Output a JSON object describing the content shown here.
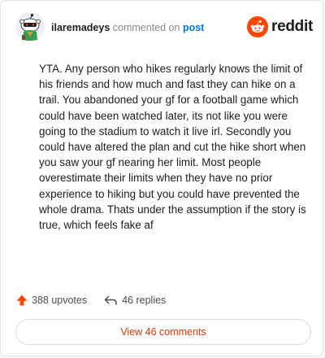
{
  "comment": {
    "username": "ilaremadeys",
    "action_text": "commented on",
    "post_link_text": "post",
    "body": "YTA. Any person who hikes regularly knows the limit of his friends and how much and fast they can hike on a trail. You abandoned your gf for a football game which could have been watched later, its not like you were going to the stadium to watch it live irl. Secondly you could have altered the plan and cut the hike short when you saw your gf nearing her limit. Most people overestimate their limits when they have no prior experience to hiking but you could have prevented the whole drama. Thats under the assumption if the story is true, which feels fake af",
    "upvotes_text": "388 upvotes",
    "replies_text": "46 replies",
    "view_comments_label": "View 46 comments"
  },
  "brand": {
    "name": "reddit",
    "logo_color": "#ff4500"
  },
  "icons": {
    "avatar": "snoo-avatar-icon",
    "logo": "reddit-snoo-icon",
    "upvote": "upvote-arrow-icon",
    "reply": "reply-arrow-icon"
  },
  "colors": {
    "upvote": "#ff4500",
    "link": "#0079d3",
    "view_button_text": "#d93a00"
  }
}
